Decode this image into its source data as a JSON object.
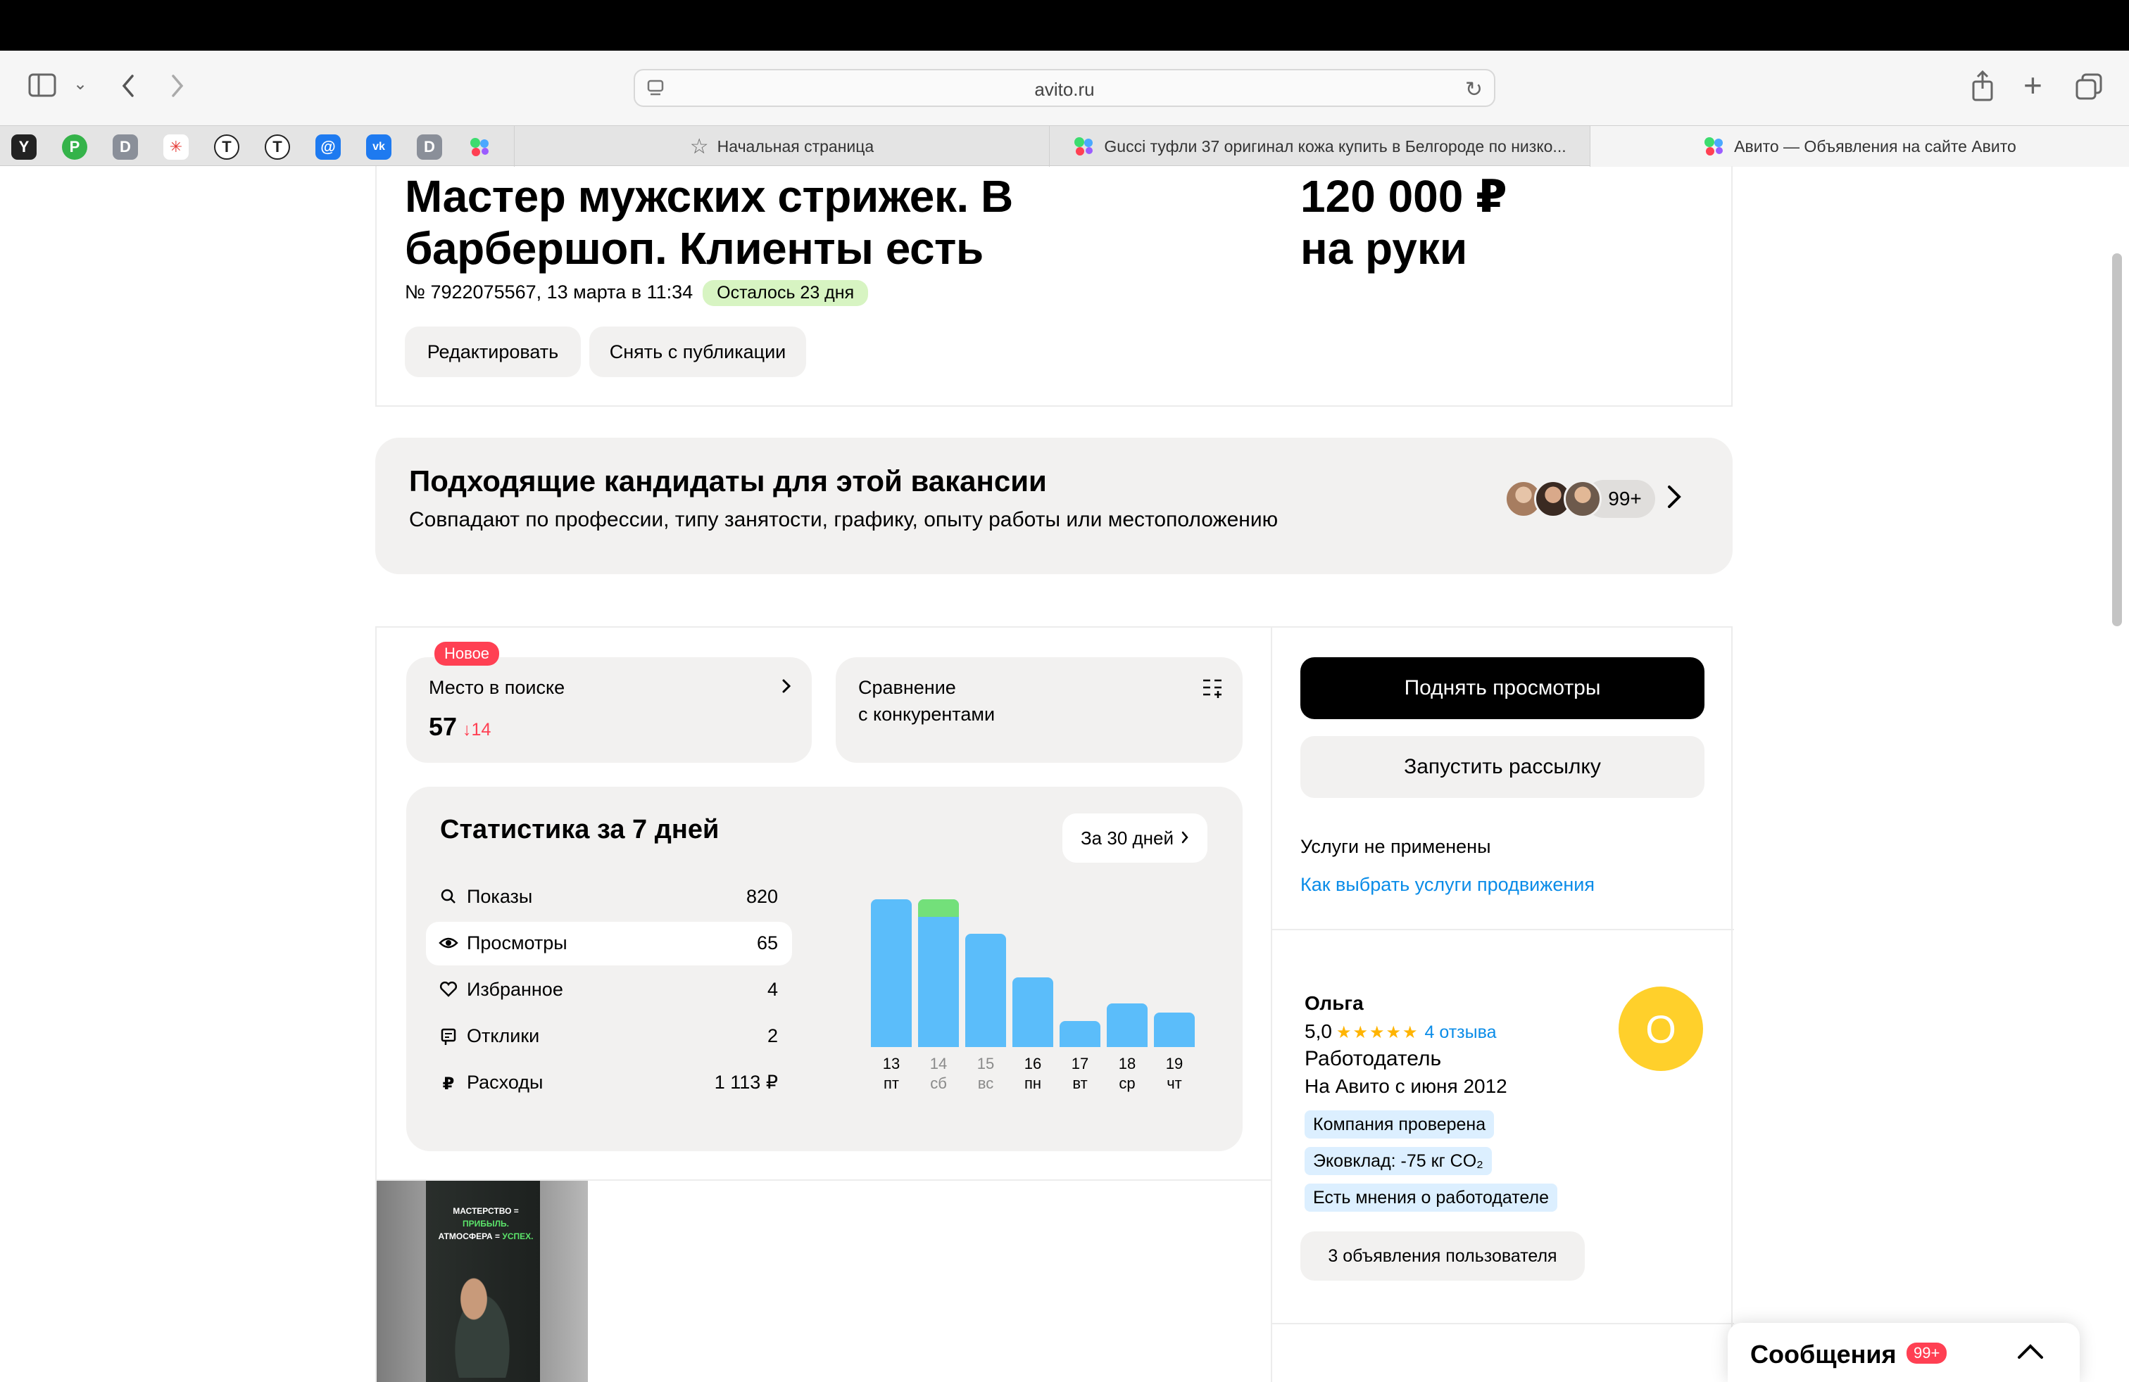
{
  "browser": {
    "url": "avito.ru",
    "tabs": [
      {
        "label": "Начальная страница"
      },
      {
        "label": "Gucci туфли 37 оригинал кожа купить в Белгороде по низко..."
      },
      {
        "label": "Авито — Объявления на сайте Авито"
      }
    ],
    "favorites": [
      "Y",
      "P",
      "D",
      "✳",
      "T",
      "T",
      "@",
      "vk",
      "D",
      "avito"
    ],
    "icons": [
      "sidebar-icon",
      "chevron-down-icon",
      "back-icon",
      "forward-icon",
      "share-icon",
      "new-tab-icon",
      "tabs-overview-icon"
    ]
  },
  "listing": {
    "title_line1": "Мастер мужских стрижек. В",
    "title_line2": "барбершоп. Клиенты есть",
    "salary_line1": "120 000 ₽",
    "salary_line2": "на руки",
    "meta": "№ 7922075567, 13 марта в 11:34",
    "remaining": "Осталось 23 дня",
    "edit_label": "Редактировать",
    "unpublish_label": "Снять с публикации"
  },
  "candidates": {
    "title": "Подходящие кандидаты для этой вакансии",
    "subtitle": "Совпадают по профессии, типу занятости, графику, опыту работы или местоположению",
    "count": "99+"
  },
  "place": {
    "badge": "Новое",
    "label": "Место в поиске",
    "value": "57",
    "delta": "↓14"
  },
  "compare": {
    "label_line1": "Сравнение",
    "label_line2": "с конкурентами"
  },
  "stats": {
    "title": "Статистика за 7 дней",
    "period_label": "За 30 дней",
    "rows": [
      {
        "icon": "search-icon",
        "name": "Показы",
        "value": "820"
      },
      {
        "icon": "eye-icon",
        "name": "Просмотры",
        "value": "65"
      },
      {
        "icon": "heart-icon",
        "name": "Избранное",
        "value": "4"
      },
      {
        "icon": "response-icon",
        "name": "Отклики",
        "value": "2"
      },
      {
        "icon": "ruble-icon",
        "name": "Расходы",
        "value": "1 113 ₽"
      }
    ]
  },
  "chart_data": {
    "type": "bar",
    "categories": [
      "13 пт",
      "14 сб",
      "15 вс",
      "16 пн",
      "17 вт",
      "18 ср",
      "19 чт"
    ],
    "day_numbers": [
      "13",
      "14",
      "15",
      "16",
      "17",
      "18",
      "19"
    ],
    "day_names": [
      "пт",
      "сб",
      "вс",
      "пн",
      "вт",
      "ср",
      "чт"
    ],
    "weekend": [
      false,
      true,
      true,
      false,
      false,
      false,
      false
    ],
    "series": [
      {
        "values": [
          17,
          15,
          13,
          8,
          3,
          5,
          4
        ],
        "color": "#5bbdfa"
      },
      {
        "values": [
          0,
          2,
          0,
          0,
          0,
          0,
          0
        ],
        "color": "#73e07a"
      }
    ],
    "ylim": [
      0,
      17
    ]
  },
  "promo": {
    "raise_label": "Поднять просмотры",
    "mailing_label": "Запустить рассылку",
    "services_note": "Услуги не применены",
    "services_link": "Как выбрать услуги продвижения"
  },
  "seller": {
    "name": "Ольга",
    "rating": "5,0",
    "stars": "★★★★★",
    "reviews": "4 отзыва",
    "role": "Работодатель",
    "since": "На Авито с июня 2012",
    "avatar_letter": "О",
    "tags": [
      "Компания проверена",
      "Эковклад: -75 кг CO₂",
      "Есть мнения о работодателе"
    ],
    "ads_label": "3 объявления пользователя"
  },
  "thumbnail": {
    "line1a": "МАСТЕРСТВО = ",
    "line1b": "ПРИБЫЛЬ.",
    "line2a": "АТМОСФЕРА = ",
    "line2b": "УСПЕХ."
  },
  "messages": {
    "label": "Сообщения",
    "badge": "99+"
  }
}
